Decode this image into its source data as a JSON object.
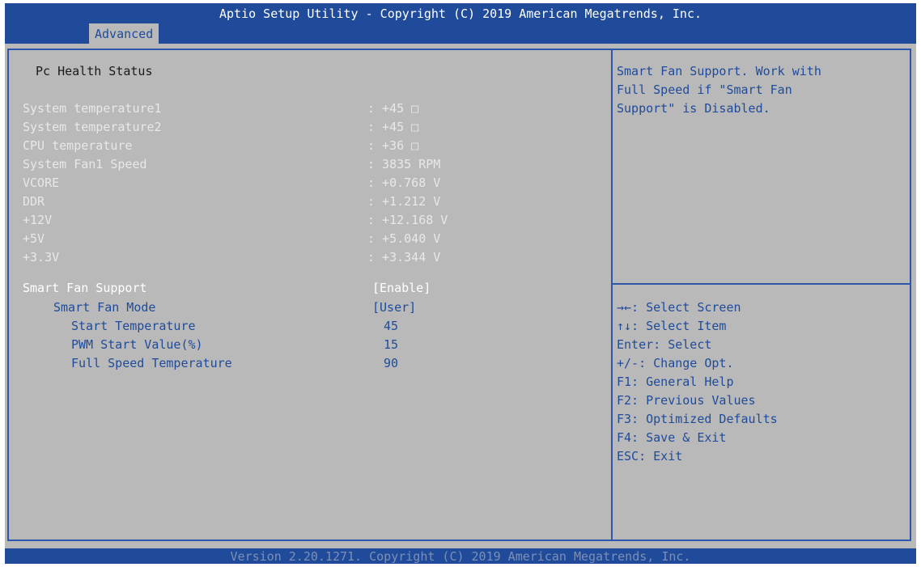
{
  "title": "Aptio Setup Utility - Copyright (C) 2019 American Megatrends, Inc.",
  "active_tab": "Advanced",
  "section_heading": "Pc Health Status",
  "readings": [
    {
      "label": "System temperature1",
      "value": ": +45 □"
    },
    {
      "label": "System temperature2",
      "value": ": +45 □"
    },
    {
      "label": "CPU temperature",
      "value": ": +36 □"
    },
    {
      "label": "System Fan1 Speed",
      "value": ": 3835 RPM"
    },
    {
      "label": "VCORE",
      "value": ": +0.768 V"
    },
    {
      "label": "DDR",
      "value": ": +1.212 V"
    },
    {
      "label": "+12V",
      "value": ": +12.168 V"
    },
    {
      "label": "+5V",
      "value": ": +5.040 V"
    },
    {
      "label": "+3.3V",
      "value": ": +3.344 V"
    }
  ],
  "settings": {
    "smart_fan_support": {
      "label": "Smart Fan Support",
      "value": "[Enable]"
    },
    "smart_fan_mode": {
      "label": "Smart Fan Mode",
      "value": "[User]"
    },
    "start_temperature": {
      "label": "Start Temperature",
      "value": "45"
    },
    "pwm_start_value": {
      "label": "PWM Start Value(%)",
      "value": "15"
    },
    "full_speed_temperature": {
      "label": "Full Speed Temperature",
      "value": "90"
    }
  },
  "help_description": [
    "Smart Fan Support. Work with",
    "Full Speed if \"Smart Fan",
    "Support\" is Disabled."
  ],
  "key_help": [
    "→←: Select Screen",
    "↑↓: Select Item",
    "Enter: Select",
    "+/-: Change Opt.",
    "F1: General Help",
    "F2: Previous Values",
    "F3: Optimized Defaults",
    "F4: Save & Exit",
    "ESC: Exit"
  ],
  "footer": "Version 2.20.1271. Copyright (C) 2019 American Megatrends, Inc.",
  "colors": {
    "bar_blue": "#1f4b9a",
    "panel_gray": "#b9b9b9",
    "border_blue": "#2e57ac",
    "readonly_text": "#e8e8e8",
    "selected_text": "#ffffff",
    "option_text": "#1f4b9a"
  }
}
